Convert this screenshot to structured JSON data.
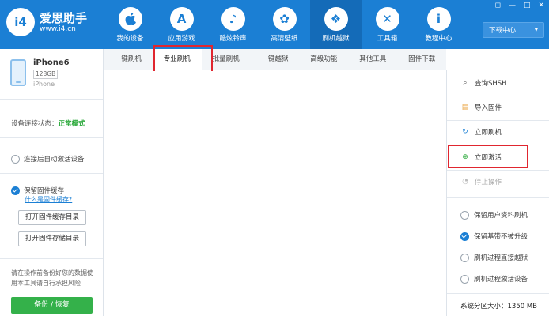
{
  "app": {
    "name": "爱思助手",
    "url": "www.i4.cn",
    "logo_mark": "i4"
  },
  "nav": [
    {
      "label": "我的设备",
      "glyph": "",
      "icon": "apple-icon"
    },
    {
      "label": "应用游戏",
      "glyph": "A",
      "icon": "app-store-icon"
    },
    {
      "label": "酷炫铃声",
      "glyph": "♪",
      "icon": "bell-icon"
    },
    {
      "label": "高清壁纸",
      "glyph": "✿",
      "icon": "flower-icon"
    },
    {
      "label": "刷机越狱",
      "glyph": "❖",
      "icon": "dropbox-icon"
    },
    {
      "label": "工具箱",
      "glyph": "✕",
      "icon": "tools-icon"
    },
    {
      "label": "教程中心",
      "glyph": "i",
      "icon": "info-icon"
    }
  ],
  "header": {
    "download_center": "下载中心",
    "minimize_glyph": "—",
    "restore_glyph": "□",
    "close_glyph": "✕",
    "settings_glyph": "◻"
  },
  "device": {
    "name": "iPhone6",
    "capacity": "128GB",
    "model": "iPhone"
  },
  "left": {
    "status_label": "设备连接状态：",
    "status_value": "正常模式",
    "auto_activate": "连接后自动激活设备",
    "keep_cache": "保留固件缓存",
    "cache_link": "什么是固件缓存?",
    "open_cache_dir": "打开固件缓存目录",
    "open_store_dir": "打开固件存储目录",
    "warning": "请在操作前备份好您的数据使用本工具请自行承担风险",
    "backup_button": "备份 / 恢复"
  },
  "tabs": [
    "一键刷机",
    "专业刷机",
    "批量刷机",
    "一键越狱",
    "高级功能",
    "其他工具",
    "固件下载"
  ],
  "active_tab": "专业刷机",
  "right": {
    "actions": [
      {
        "label": "查询SHSH",
        "glyph": "⌕",
        "color": "#555555"
      },
      {
        "label": "导入固件",
        "glyph": "▤",
        "color": "#e9a23b"
      },
      {
        "label": "立即刷机",
        "glyph": "↻",
        "color": "#1b7fd4"
      },
      {
        "label": "立即激活",
        "glyph": "⊕",
        "color": "#27a737"
      },
      {
        "label": "停止操作",
        "glyph": "◔",
        "color": "#bbbbbb"
      }
    ],
    "options": [
      {
        "label": "保留用户资料刷机",
        "checked": false
      },
      {
        "label": "保留基带不被升级",
        "checked": true
      },
      {
        "label": "刷机过程直接越狱",
        "checked": false
      },
      {
        "label": "刷机过程激活设备",
        "checked": false
      }
    ],
    "system_partition": "系统分区大小：1350 MB"
  },
  "colors": {
    "header_blue": "#1b7fd4",
    "highlight_red": "#e0262f",
    "status_green": "#27a737",
    "backup_green": "#34b14a"
  }
}
